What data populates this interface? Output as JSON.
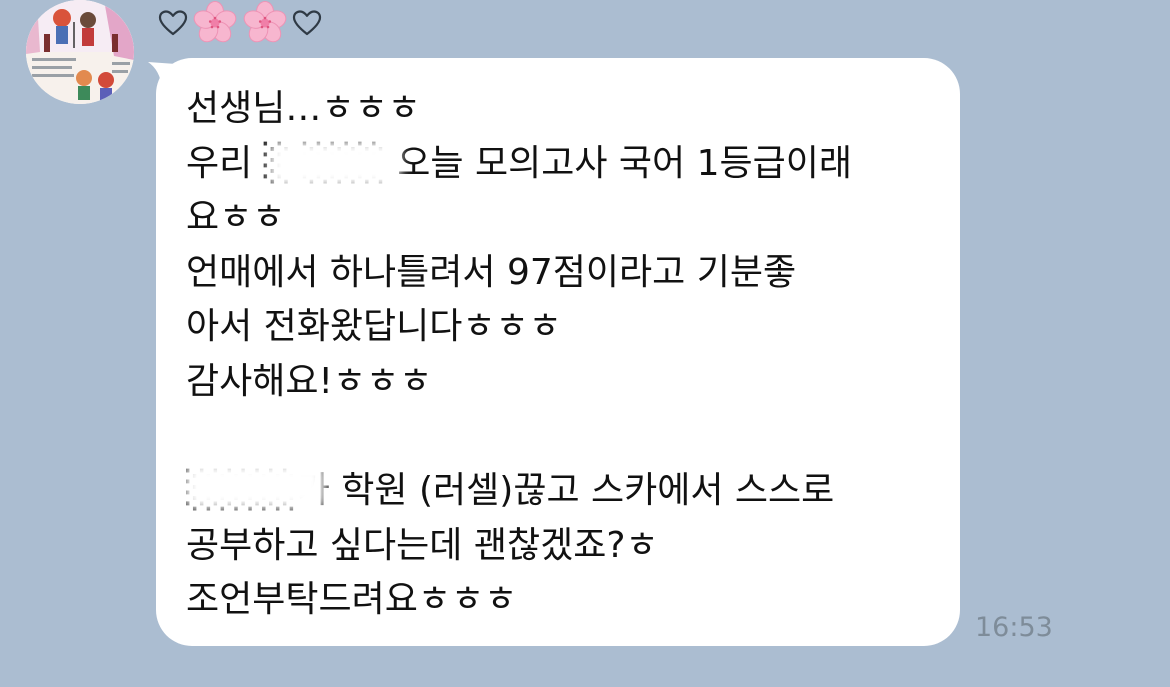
{
  "chat": {
    "background_color": "#abbdd1",
    "reactions": [
      "heart-icon",
      "cherry-blossom-icon",
      "cherry-blossom-icon",
      "heart-icon"
    ],
    "message": {
      "lines": [
        "선생님…ㅎㅎㅎ",
        "우리 ░ ░░░ 오늘 모의고사 국어 1등급이래",
        "요ㅎㅎ",
        "언매에서 하나틀려서 97점이라고 기분좋",
        "아서 전화왔답니다ㅎㅎㅎ",
        "감사해요!ㅎㅎㅎ",
        "",
        "░░░░가 학원 (러셀)끊고 스카에서 스스로",
        "공부하고 싶다는데 괜찮겠죠?ㅎ",
        "조언부탁드려요ㅎㅎㅎ"
      ]
    },
    "timestamp": "16:53"
  }
}
